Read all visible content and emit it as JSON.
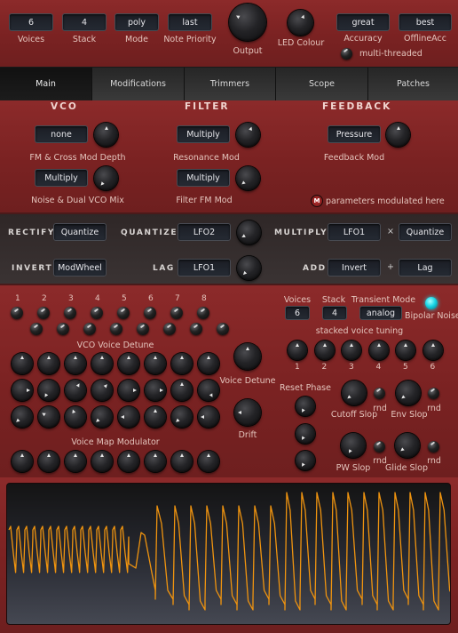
{
  "top_bar": {
    "selectors": [
      {
        "label": "Voices",
        "value": "6"
      },
      {
        "label": "Stack",
        "value": "4"
      },
      {
        "label": "Mode",
        "value": "poly"
      },
      {
        "label": "Note Priority",
        "value": "last"
      }
    ],
    "output_label": "Output",
    "led_colour_label": "LED Colour",
    "accuracy": {
      "label": "Accuracy",
      "value": "great"
    },
    "offline_accuracy": {
      "label": "OfflineAcc",
      "value": "best"
    },
    "multithreaded_label": "multi-threaded"
  },
  "tabs": [
    {
      "label": "Main",
      "active": true
    },
    {
      "label": "Modifications",
      "active": false
    },
    {
      "label": "Trimmers",
      "active": false
    },
    {
      "label": "Scope",
      "active": false
    },
    {
      "label": "Patches",
      "active": false
    }
  ],
  "sections": {
    "vco": {
      "title": "VCO",
      "fm_source": "none",
      "fm_label": "FM & Cross Mod Depth",
      "noise_source": "Multiply",
      "noise_label": "Noise & Dual VCO Mix"
    },
    "filter": {
      "title": "FILTER",
      "resonance_source": "Multiply",
      "resonance_label": "Resonance Mod",
      "fm_source": "Multiply",
      "fm_label": "Filter FM Mod"
    },
    "feedback": {
      "title": "FEEDBACK",
      "source": "Pressure",
      "label": "Feedback Mod",
      "mod_badge": "M",
      "mod_note": "parameters modulated here"
    }
  },
  "modifiers": {
    "rectify": {
      "label": "RECTIFY",
      "value": "Quantize"
    },
    "invert": {
      "label": "INVERT",
      "value": "ModWheel"
    },
    "quantize": {
      "label": "QUANTIZE",
      "value": "LFO2"
    },
    "lag": {
      "label": "LAG",
      "value": "LFO1"
    },
    "multiply": {
      "label": "MULTIPLY",
      "a": "LFO1",
      "op": "×",
      "b": "Quantize"
    },
    "add": {
      "label": "ADD",
      "a": "Invert",
      "op": "+",
      "b": "Lag"
    }
  },
  "voices_panel": {
    "voice_numbers": [
      "1",
      "2",
      "3",
      "4",
      "5",
      "6",
      "7",
      "8"
    ],
    "vco_voice_detune_label": "VCO Voice Detune",
    "voice_detune_label": "Voice Detune",
    "drift_label": "Drift",
    "voice_map_label": "Voice Map Modulator"
  },
  "right_panel": {
    "voices": {
      "label": "Voices",
      "value": "6"
    },
    "stack": {
      "label": "Stack",
      "value": "4"
    },
    "transient": {
      "label": "Transient Mode",
      "value": "analog"
    },
    "bipolar_noise_label": "Bipolar Noise",
    "bipolar_noise_on": true,
    "stacked_tuning_label": "stacked voice tuning",
    "stack_numbers": [
      "1",
      "2",
      "3",
      "4",
      "5",
      "6"
    ],
    "reset_phase_label": "Reset Phase",
    "slops": [
      {
        "label": "Cutoff Slop",
        "rnd": "rnd"
      },
      {
        "label": "Env Slop",
        "rnd": "rnd"
      },
      {
        "label": "PW Slop",
        "rnd": "rnd"
      },
      {
        "label": "Glide Slop",
        "rnd": "rnd"
      }
    ]
  },
  "colors": {
    "panel_red": "#7e2424",
    "led_cyan": "#19d6e6",
    "scope_trace": "#f0940f"
  }
}
